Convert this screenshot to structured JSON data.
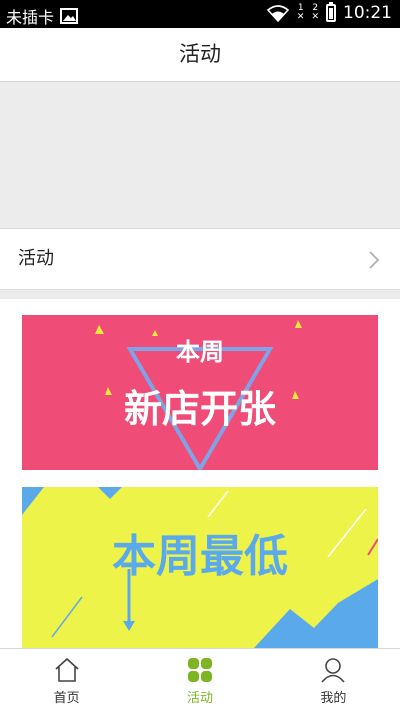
{
  "status_bar": {
    "carrier": "未插卡",
    "sim1": "1",
    "sim2": "2",
    "time": "10:21"
  },
  "header": {
    "title": "活动"
  },
  "section": {
    "label": "活动"
  },
  "banners": [
    {
      "line1": "本周",
      "line2": "新店开张",
      "bg_color": "#f04c78",
      "text_color": "#ffffff"
    },
    {
      "text": "本周最低",
      "bg_color": "#eef34a",
      "text_color": "#5aa9ea"
    }
  ],
  "nav": {
    "items": [
      {
        "label": "首页",
        "icon": "home-icon"
      },
      {
        "label": "活动",
        "icon": "grid-icon",
        "active": true
      },
      {
        "label": "我的",
        "icon": "user-icon"
      }
    ],
    "active_color": "#7cb424"
  }
}
